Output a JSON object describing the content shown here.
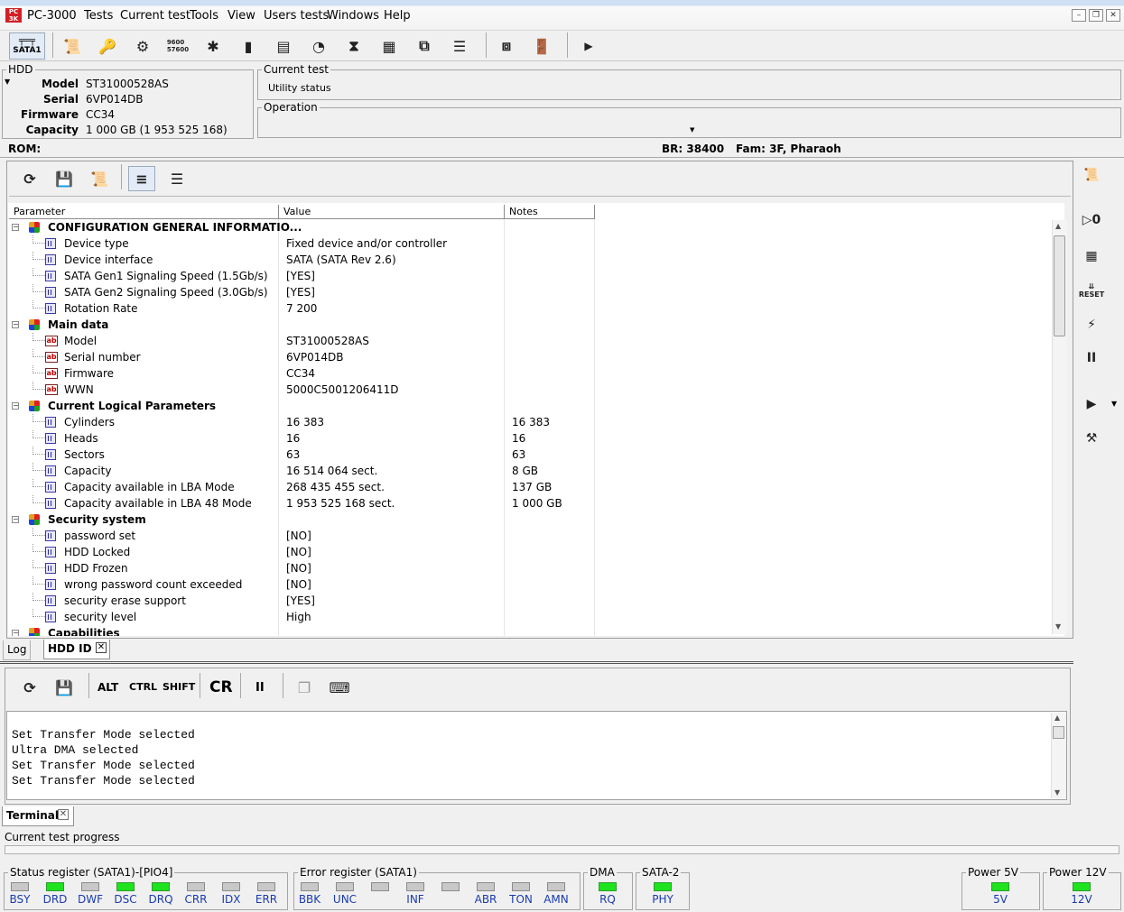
{
  "app": {
    "title": "PC-3000"
  },
  "menu": [
    "Tests",
    "Current test",
    "Tools",
    "View",
    "Users tests",
    "Windows",
    "Help"
  ],
  "toolbar": {
    "sata_label": "SATA1"
  },
  "hdd": {
    "group_title": "HDD",
    "fields": [
      {
        "label": "Model",
        "value": "ST31000528AS"
      },
      {
        "label": "Serial",
        "value": "6VP014DB"
      },
      {
        "label": "Firmware",
        "value": "CC34"
      },
      {
        "label": "Capacity",
        "value": "1 000 GB (1 953 525 168)"
      }
    ]
  },
  "current_test": {
    "group_title": "Current test",
    "value": "Utility status"
  },
  "operation": {
    "group_title": "Operation"
  },
  "rom": {
    "label": "ROM:",
    "br": "BR: 38400",
    "fam": "Fam: 3F, Pharaoh"
  },
  "grid": {
    "columns": [
      "Parameter",
      "Value",
      "Notes"
    ],
    "rows": [
      {
        "group": true,
        "name": "CONFIGURATION GENERAL INFORMATIO...",
        "value": "",
        "notes": ""
      },
      {
        "icon": "grid",
        "name": "Device type",
        "value": "Fixed device and/or controller",
        "notes": ""
      },
      {
        "icon": "grid",
        "name": "Device interface",
        "value": "SATA (SATA Rev 2.6)",
        "notes": ""
      },
      {
        "icon": "grid",
        "name": "SATA Gen1 Signaling Speed (1.5Gb/s)",
        "value": "[YES]",
        "notes": ""
      },
      {
        "icon": "grid",
        "name": "SATA Gen2 Signaling Speed (3.0Gb/s)",
        "value": "[YES]",
        "notes": ""
      },
      {
        "icon": "grid",
        "name": "Rotation Rate",
        "value": "7 200",
        "notes": ""
      },
      {
        "group": true,
        "name": "Main data",
        "value": "",
        "notes": ""
      },
      {
        "icon": "ab",
        "name": "Model",
        "value": "ST31000528AS",
        "notes": ""
      },
      {
        "icon": "ab",
        "name": "Serial number",
        "value": "6VP014DB",
        "notes": ""
      },
      {
        "icon": "ab",
        "name": "Firmware",
        "value": "CC34",
        "notes": ""
      },
      {
        "icon": "ab",
        "name": "WWN",
        "value": "5000C5001206411D",
        "notes": ""
      },
      {
        "group": true,
        "name": "Current Logical Parameters",
        "value": "",
        "notes": ""
      },
      {
        "icon": "grid",
        "name": "Cylinders",
        "value": "16 383",
        "notes": "16 383"
      },
      {
        "icon": "grid",
        "name": "Heads",
        "value": "16",
        "notes": "16"
      },
      {
        "icon": "grid",
        "name": "Sectors",
        "value": "63",
        "notes": "63"
      },
      {
        "icon": "grid",
        "name": "Capacity",
        "value": "16 514 064 sect.",
        "notes": "8 GB"
      },
      {
        "icon": "grid",
        "name": "Capacity available in LBA Mode",
        "value": "268 435 455 sect.",
        "notes": "137 GB"
      },
      {
        "icon": "grid",
        "name": "Capacity available in LBA 48 Mode",
        "value": "1 953 525 168 sect.",
        "notes": "1 000 GB"
      },
      {
        "group": true,
        "name": "Security system",
        "value": "",
        "notes": ""
      },
      {
        "icon": "grid",
        "name": "password set",
        "value": "[NO]",
        "notes": ""
      },
      {
        "icon": "grid",
        "name": "HDD Locked",
        "value": "[NO]",
        "notes": ""
      },
      {
        "icon": "grid",
        "name": "HDD Frozen",
        "value": "[NO]",
        "notes": ""
      },
      {
        "icon": "grid",
        "name": "wrong password count exceeded",
        "value": "[NO]",
        "notes": ""
      },
      {
        "icon": "grid",
        "name": "security erase support",
        "value": "[YES]",
        "notes": ""
      },
      {
        "icon": "grid",
        "name": "security level",
        "value": "High",
        "notes": ""
      },
      {
        "group": true,
        "name": "Capabilities",
        "value": "",
        "notes": ""
      }
    ]
  },
  "tabs_top": {
    "log": "Log",
    "hdd_id": "HDD ID"
  },
  "term_toolbar": {
    "alt": "ALT",
    "ctrl": "CTRL",
    "shift": "SHIFT",
    "cr": "CR"
  },
  "terminal": {
    "lines": [
      "Set Transfer Mode selected",
      "Ultra DMA selected",
      "Set Transfer Mode selected",
      "Set Transfer Mode selected"
    ],
    "tab": "Terminal"
  },
  "progress": {
    "label": "Current test progress",
    "value": 0
  },
  "status_register": {
    "title": "Status register (SATA1)-[PIO4]",
    "leds": [
      {
        "name": "BSY",
        "on": false
      },
      {
        "name": "DRD",
        "on": true
      },
      {
        "name": "DWF",
        "on": false
      },
      {
        "name": "DSC",
        "on": true
      },
      {
        "name": "DRQ",
        "on": true
      },
      {
        "name": "CRR",
        "on": false
      },
      {
        "name": "IDX",
        "on": false
      },
      {
        "name": "ERR",
        "on": false
      }
    ]
  },
  "error_register": {
    "title": "Error register (SATA1)",
    "leds": [
      {
        "name": "BBK",
        "on": false
      },
      {
        "name": "UNC",
        "on": false
      },
      {
        "name": "",
        "on": false
      },
      {
        "name": "INF",
        "on": false
      },
      {
        "name": "",
        "on": false
      },
      {
        "name": "ABR",
        "on": false
      },
      {
        "name": "TON",
        "on": false
      },
      {
        "name": "AMN",
        "on": false
      }
    ]
  },
  "dma": {
    "title": "DMA",
    "led": "RQ",
    "on": true
  },
  "sata2": {
    "title": "SATA-2",
    "led": "PHY",
    "on": true
  },
  "power5": {
    "title": "Power 5V",
    "led": "5V",
    "on": true
  },
  "power12": {
    "title": "Power 12V",
    "led": "12V",
    "on": true
  },
  "colors": {
    "led_on": "#1ee31e",
    "led_off": "#c8c8c8",
    "led_label": "#1a3bb0"
  }
}
